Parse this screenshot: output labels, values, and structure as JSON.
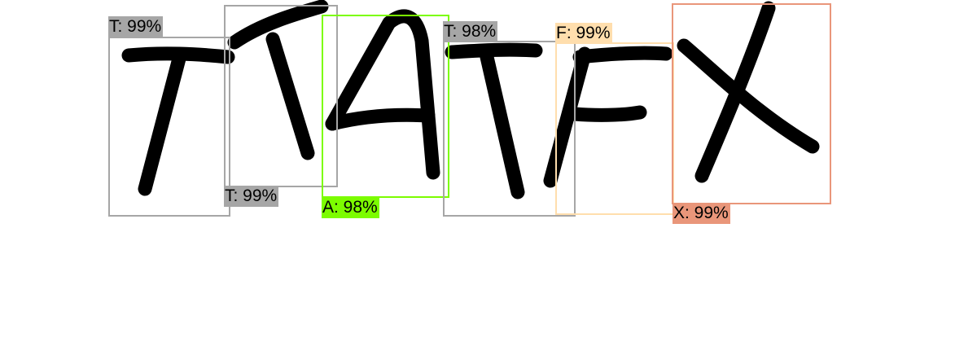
{
  "detections": [
    {
      "id": "d1",
      "label": "T: 99%",
      "color": "#a6a6a6"
    },
    {
      "id": "d2",
      "label": "T: 99%",
      "color": "#a6a6a6"
    },
    {
      "id": "d3",
      "label": "A: 98%",
      "color": "#7cfc00"
    },
    {
      "id": "d4",
      "label": "T: 98%",
      "color": "#a6a6a6"
    },
    {
      "id": "d5",
      "label": "F: 99%",
      "color": "#ffdead"
    },
    {
      "id": "d6",
      "label": "X: 99%",
      "color": "#e9967a"
    }
  ],
  "glyph_ink_color": "#000000"
}
